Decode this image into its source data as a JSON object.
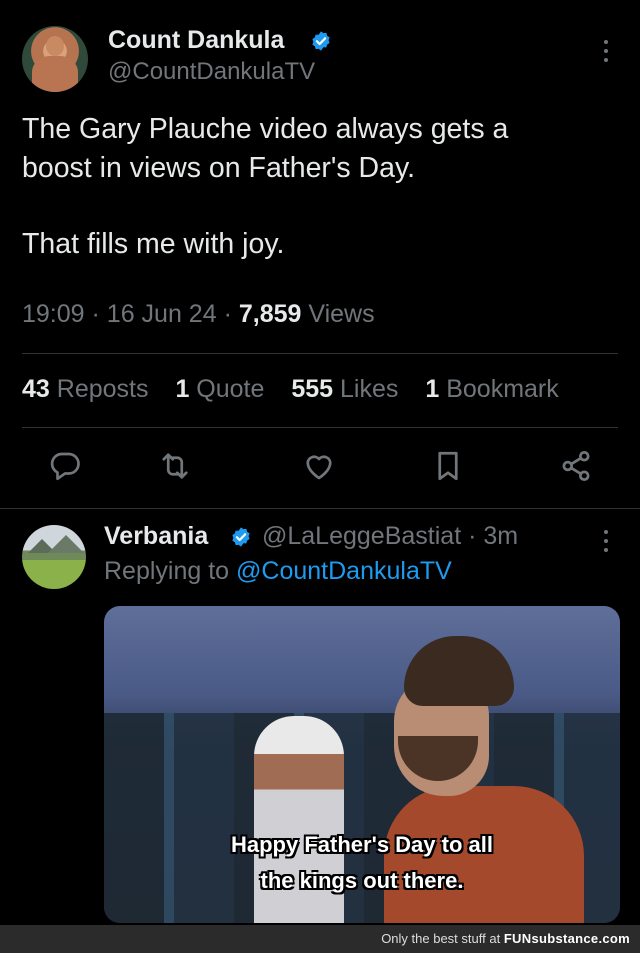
{
  "tweet": {
    "author_name": "Count Dankula",
    "author_handle": "@CountDankulaTV",
    "text_line1": "The Gary Plauche video always gets a",
    "text_line2": "boost in views on Father's Day.",
    "text_line3": "That fills me with joy.",
    "time": "19:09",
    "separator": "·",
    "date": "16 Jun 24",
    "views_count": "7,859",
    "views_label": "Views",
    "stats": [
      {
        "count": "43",
        "label": "Reposts"
      },
      {
        "count": "1",
        "label": "Quote"
      },
      {
        "count": "555",
        "label": "Likes"
      },
      {
        "count": "1",
        "label": "Bookmark"
      }
    ],
    "actions": [
      "reply-icon",
      "repost-icon",
      "like-icon",
      "bookmark-icon",
      "share-icon"
    ]
  },
  "reply": {
    "author_name": "Verbania",
    "author_handle": "@LaLeggeBastiat",
    "separator": "·",
    "time_ago": "3m",
    "replying_prefix": "Replying to",
    "replying_to": "@CountDankulaTV",
    "media_caption_line1": "Happy Father's Day to all",
    "media_caption_line2": "the kings out there."
  },
  "footer": {
    "text": "Only the best stuff at",
    "brand_bold": "FUN",
    "brand_rest": "substance",
    "domain": ".com"
  },
  "colors": {
    "background": "#000000",
    "text": "#e7e9ea",
    "muted": "#71767b",
    "link": "#1d9bf0",
    "verified": "#1d9bf0"
  }
}
